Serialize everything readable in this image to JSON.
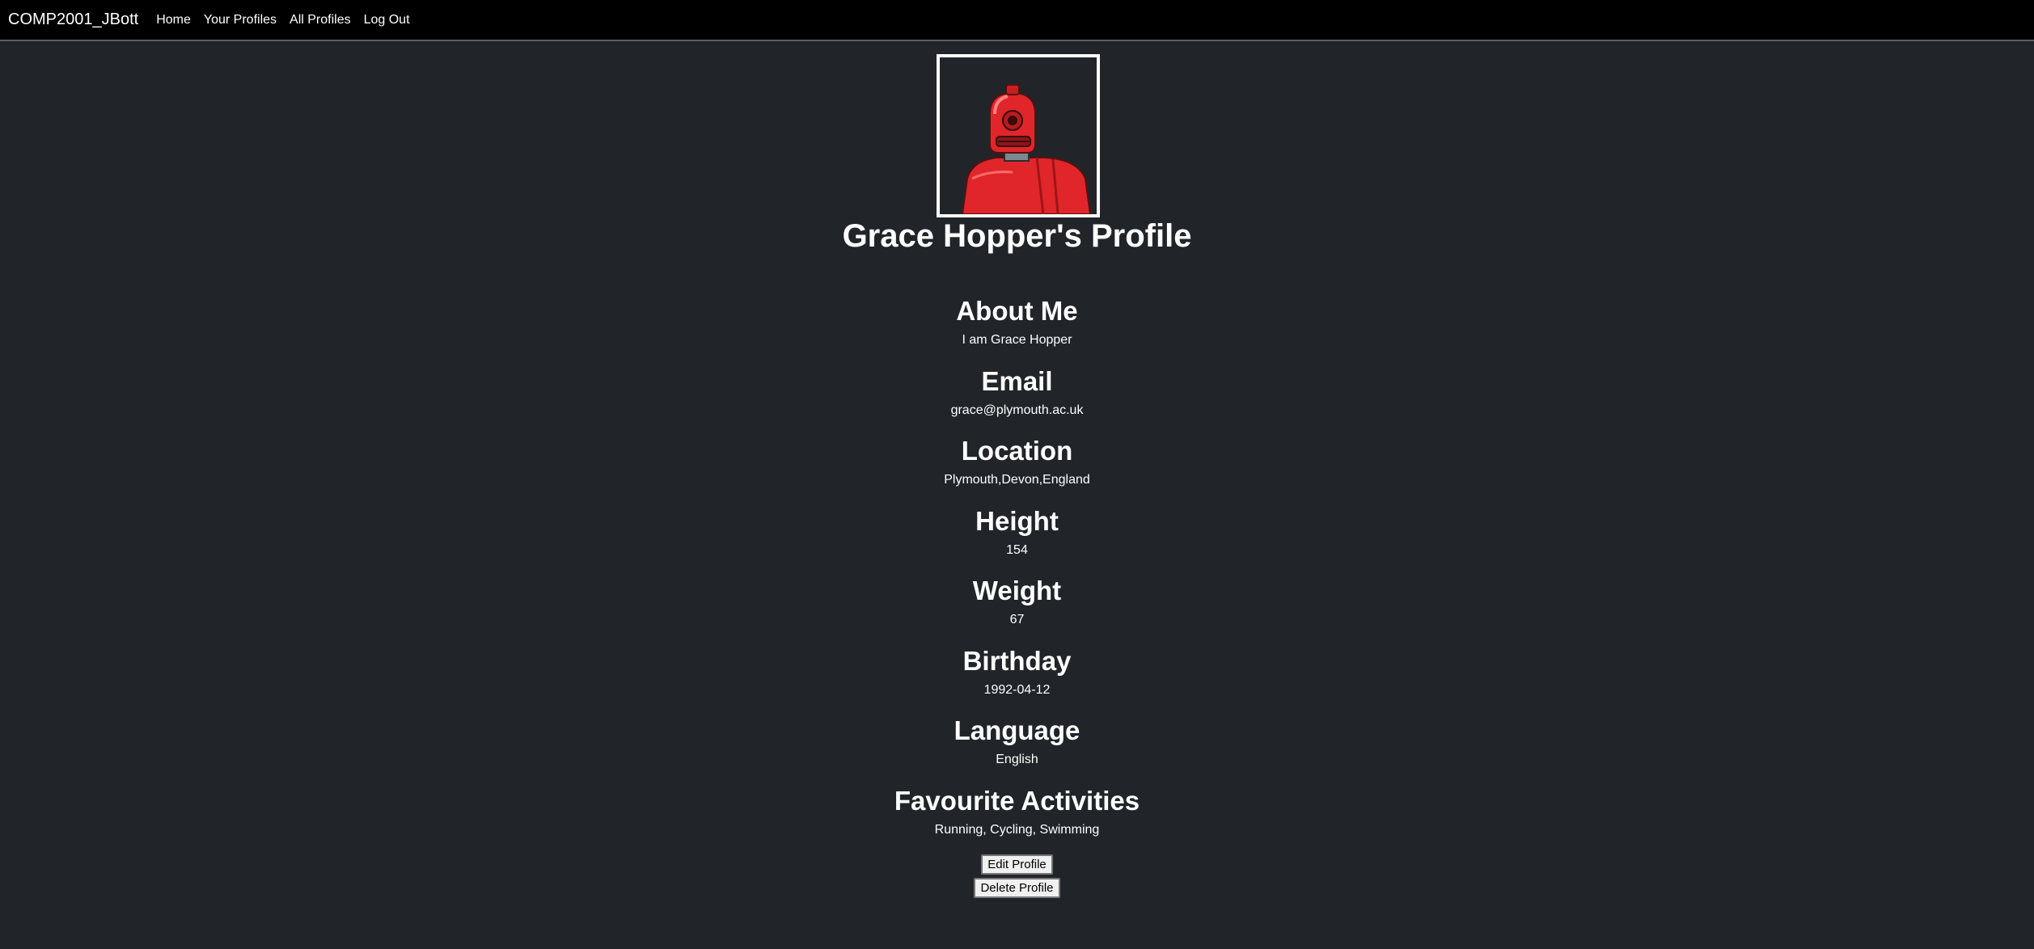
{
  "navbar": {
    "brand": "COMP2001_JBott",
    "links": [
      "Home",
      "Your Profiles",
      "All Profiles",
      "Log Out"
    ]
  },
  "profile": {
    "avatar_icon": "red-robot-avatar",
    "title": "Grace Hopper's Profile"
  },
  "sections": [
    {
      "heading": "About Me",
      "value": "I am Grace Hopper"
    },
    {
      "heading": "Email",
      "value": "grace@plymouth.ac.uk"
    },
    {
      "heading": "Location",
      "value": "Plymouth,Devon,England"
    },
    {
      "heading": "Height",
      "value": "154"
    },
    {
      "heading": "Weight",
      "value": "67"
    },
    {
      "heading": "Birthday",
      "value": "1992-04-12"
    },
    {
      "heading": "Language",
      "value": "English"
    },
    {
      "heading": "Favourite Activities",
      "value": "Running, Cycling, Swimming"
    }
  ],
  "buttons": {
    "edit_label": "Edit Profile",
    "delete_label": "Delete Profile"
  },
  "colors": {
    "page_background": "#212529",
    "navbar_background": "#000000",
    "avatar_robot": "#e0262a"
  }
}
